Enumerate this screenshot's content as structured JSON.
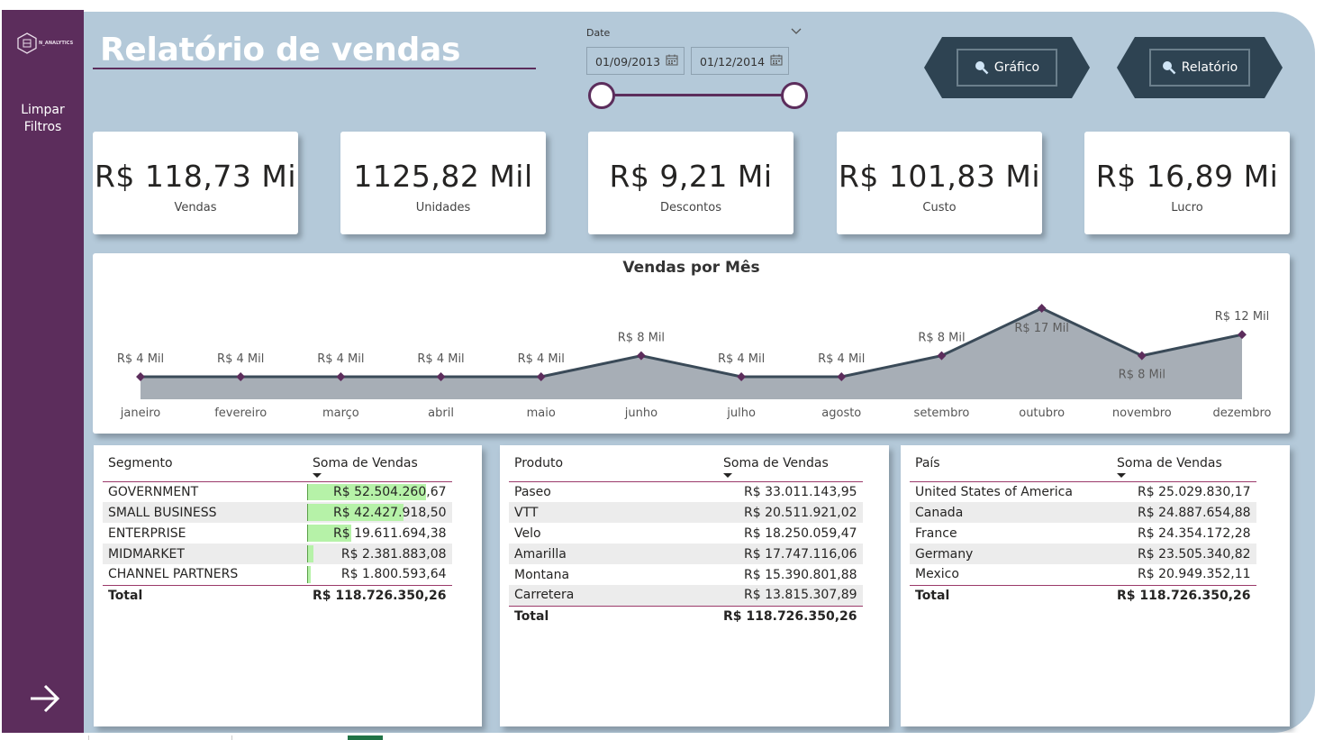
{
  "sidebar": {
    "logo_text": "N_ANALYTICS",
    "clear_filters_label": "Limpar Filtros",
    "next_icon": "arrow-right-icon"
  },
  "header": {
    "title": "Relatório de vendas"
  },
  "date_slicer": {
    "label": "Date",
    "start": "01/09/2013",
    "end": "01/12/2014"
  },
  "nav": {
    "chart_button": "Gráfico",
    "report_button": "Relatório"
  },
  "kpis": [
    {
      "value": "R$ 118,73 Mi",
      "label": "Vendas"
    },
    {
      "value": "1125,82 Mil",
      "label": "Unidades"
    },
    {
      "value": "R$ 9,21 Mi",
      "label": "Descontos"
    },
    {
      "value": "R$ 101,83 Mi",
      "label": "Custo"
    },
    {
      "value": "R$ 16,89 Mi",
      "label": "Lucro"
    }
  ],
  "chart_data": {
    "type": "area",
    "title": "Vendas por Mês",
    "categories": [
      "janeiro",
      "fevereiro",
      "março",
      "abril",
      "maio",
      "junho",
      "julho",
      "agosto",
      "setembro",
      "outubro",
      "novembro",
      "dezembro"
    ],
    "series": [
      {
        "values": [
          4,
          4,
          4,
          4,
          4,
          8,
          4,
          4,
          8,
          17,
          8,
          12
        ],
        "labels": [
          "R$ 4 Mil",
          "R$ 4 Mil",
          "R$ 4 Mil",
          "R$ 4 Mil",
          "R$ 4 Mil",
          "R$ 8 Mil",
          "R$ 4 Mil",
          "R$ 4 Mil",
          "R$ 8 Mil",
          "R$ 17 Mil",
          "R$ 8 Mil",
          "R$ 12 Mil"
        ]
      }
    ],
    "ylim": [
      0,
      17
    ],
    "colors": {
      "line": "#3a4a58",
      "fill": "#a7aeb6",
      "marker": "#5c2d5c"
    }
  },
  "segment_table": {
    "headers": [
      "Segmento",
      "Soma de Vendas"
    ],
    "rows": [
      {
        "name": "GOVERNMENT",
        "value": "R$ 52.504.260,67",
        "share": 1.0
      },
      {
        "name": "SMALL BUSINESS",
        "value": "R$ 42.427.918,50",
        "share": 0.81
      },
      {
        "name": "ENTERPRISE",
        "value": "R$ 19.611.694,38",
        "share": 0.37
      },
      {
        "name": "MIDMARKET",
        "value": "R$ 2.381.883,08",
        "share": 0.05
      },
      {
        "name": "CHANNEL PARTNERS",
        "value": "R$ 1.800.593,64",
        "share": 0.03
      }
    ],
    "total_label": "Total",
    "total_value": "R$ 118.726.350,26"
  },
  "product_table": {
    "headers": [
      "Produto",
      "Soma de Vendas"
    ],
    "rows": [
      {
        "name": "Paseo",
        "value": "R$ 33.011.143,95"
      },
      {
        "name": "VTT",
        "value": "R$ 20.511.921,02"
      },
      {
        "name": "Velo",
        "value": "R$ 18.250.059,47"
      },
      {
        "name": "Amarilla",
        "value": "R$ 17.747.116,06"
      },
      {
        "name": "Montana",
        "value": "R$ 15.390.801,88"
      },
      {
        "name": "Carretera",
        "value": "R$ 13.815.307,89"
      }
    ],
    "total_label": "Total",
    "total_value": "R$ 118.726.350,26"
  },
  "country_table": {
    "headers": [
      "País",
      "Soma de Vendas"
    ],
    "rows": [
      {
        "name": "United States of America",
        "value": "R$ 25.029.830,17"
      },
      {
        "name": "Canada",
        "value": "R$ 24.887.654,88"
      },
      {
        "name": "France",
        "value": "R$ 24.354.172,28"
      },
      {
        "name": "Germany",
        "value": "R$ 23.505.340,82"
      },
      {
        "name": "Mexico",
        "value": "R$ 20.949.352,11"
      }
    ],
    "total_label": "Total",
    "total_value": "R$ 118.726.350,26"
  }
}
